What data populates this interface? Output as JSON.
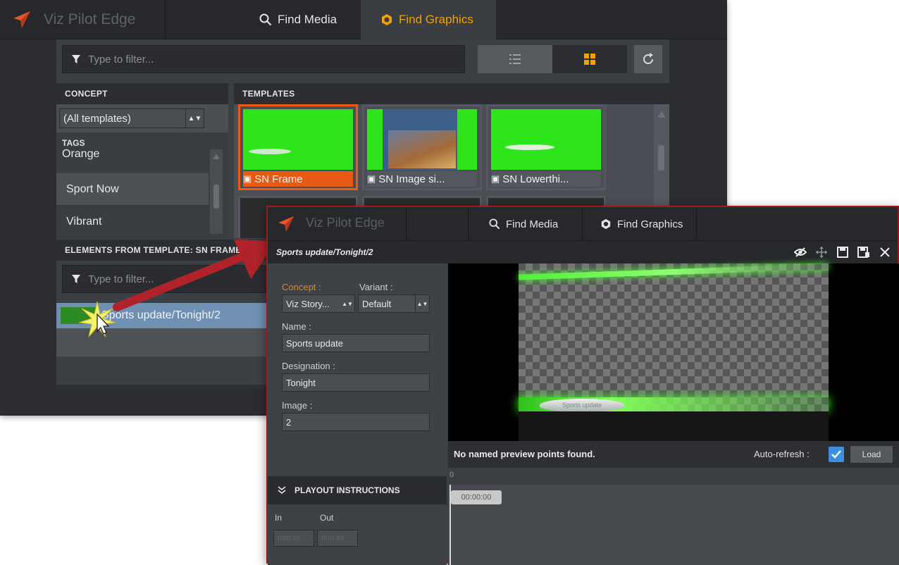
{
  "back_window": {
    "brand": "Viz Pilot Edge",
    "tabs": [
      {
        "label": "Find Media"
      },
      {
        "label": "Find Graphics"
      }
    ],
    "filter_placeholder": "Type to filter...",
    "concept_header": "CONCEPT",
    "concept_select": "(All templates)",
    "tags_header": "TAGS",
    "tags": [
      "Orange",
      "Sport Now",
      "Vibrant"
    ],
    "templates_header": "TEMPLATES",
    "templates": [
      "SN Frame",
      "SN Image si...",
      "SN Lowerthi..."
    ],
    "elements_header": "ELEMENTS FROM TEMPLATE: SN FRAME",
    "elements_filter_placeholder": "Type to filter...",
    "element_item": "Sports update/Tonight/2"
  },
  "front_window": {
    "brand": "Viz Pilot Edge",
    "tabs": [
      {
        "label": "Find Media"
      },
      {
        "label": "Find Graphics"
      }
    ],
    "path": "Sports update/Tonight/2",
    "concept_label": "Concept :",
    "concept_value": "Viz Story...",
    "variant_label": "Variant :",
    "variant_value": "Default",
    "name_label": "Name :",
    "name_value": "Sports update",
    "designation_label": "Designation :",
    "designation_value": "Tonight",
    "image_label": "Image :",
    "image_value": "2",
    "preview_status": "No named preview points found.",
    "auto_refresh_label": "Auto-refresh :",
    "load_button": "Load",
    "timeline_zero": "0",
    "timeline_tag": "00:00:00",
    "playout_header": "PLAYOUT INSTRUCTIONS",
    "in_label": "In",
    "out_label": "Out",
    "in_placeholder": "mm:ss",
    "out_placeholder": "mm:ss",
    "overlay_text": "Sports update"
  },
  "colors": {
    "accent_orange": "#f1a200",
    "selected_orange": "#e75a13",
    "green_screen": "#2ee51b",
    "arrow_red": "#b0232a",
    "checkbox_blue": "#3b8ee0"
  }
}
